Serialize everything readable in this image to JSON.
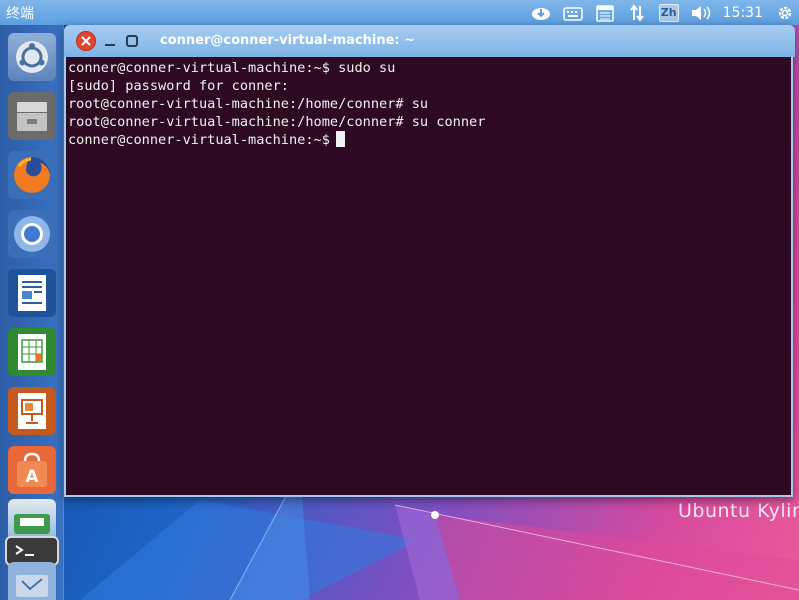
{
  "top_panel": {
    "app_title": "终端",
    "indicators": [
      {
        "icon": "software-updater-icon"
      },
      {
        "icon": "keyboard-icon"
      },
      {
        "icon": "calendar-icon"
      },
      {
        "icon": "network-updown-icon"
      },
      {
        "icon": "input-method-icon",
        "label": "Zh"
      },
      {
        "icon": "volume-icon"
      }
    ],
    "clock": "15:31",
    "settings_icon": "gear-icon"
  },
  "launcher": {
    "items": [
      {
        "icon": "dash-home-icon"
      },
      {
        "icon": "files-icon"
      },
      {
        "icon": "firefox-icon"
      },
      {
        "icon": "chromium-icon"
      },
      {
        "icon": "writer-icon"
      },
      {
        "icon": "calc-icon"
      },
      {
        "icon": "impress-icon"
      },
      {
        "icon": "software-center-icon"
      },
      {
        "icon": "workspace-switcher-icon"
      },
      {
        "icon": "terminal-icon"
      },
      {
        "icon": "trash-icon"
      }
    ]
  },
  "window": {
    "title": "conner@conner-virtual-machine: ~",
    "terminal_lines": [
      "conner@conner-virtual-machine:~$ sudo su",
      "[sudo] password for conner:",
      "root@conner-virtual-machine:/home/conner# su",
      "root@conner-virtual-machine:/home/conner# su conner",
      "conner@conner-virtual-machine:~$"
    ]
  },
  "desktop": {
    "watermark": "Ubuntu Kylin"
  },
  "colors": {
    "terminal_bg": "#2d0922",
    "panel": "#6aa8e4",
    "launcher": "#2f64ad"
  }
}
